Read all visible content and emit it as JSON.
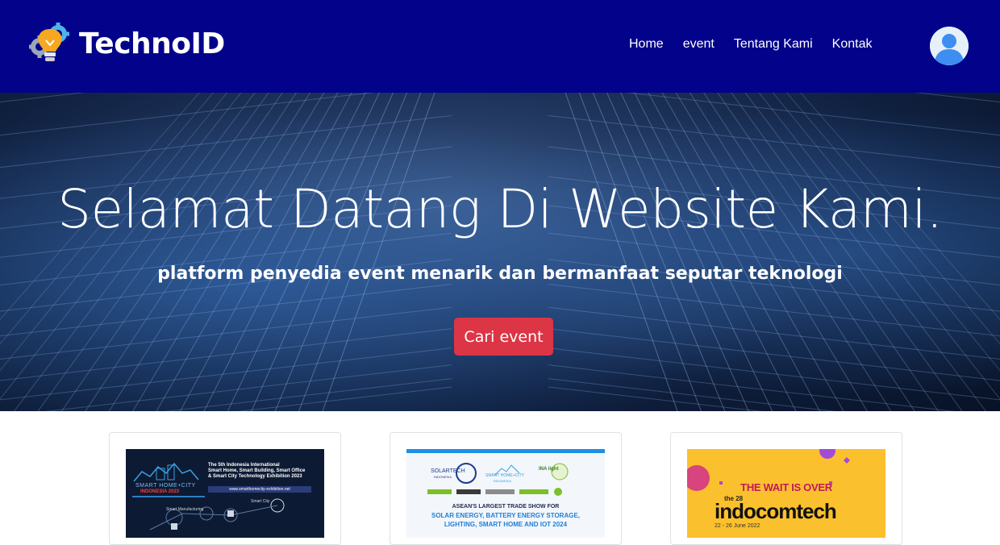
{
  "brand": {
    "name": "TechnoID",
    "logo_icon": "lightbulb-gear-icon"
  },
  "nav": {
    "items": [
      {
        "label": "Home"
      },
      {
        "label": "event"
      },
      {
        "label": "Tentang Kami"
      },
      {
        "label": "Kontak"
      }
    ],
    "avatar_icon": "user-avatar-icon"
  },
  "hero": {
    "title": "Selamat Datang Di Website Kami.",
    "subtitle": "platform penyedia event menarik dan bermanfaat seputar teknologi",
    "button_label": "Cari event"
  },
  "events": [
    {
      "name": "SMART HOME+CITY INDONESIA 2023",
      "poster_lines": [
        "The 5th Indonesia International",
        "Smart Home, Smart Building, Smart Office",
        "& Smart City Technology Exhibition 2023",
        "www.smarthomecity-exhibition.net",
        "SMART HOME+CITY",
        "INDONESIA 2023",
        "Smart Manufacturing",
        "Smart City"
      ]
    },
    {
      "name": "Solartech Indonesia 2024",
      "poster_lines": [
        "SOLARTECH",
        "INDONESIA",
        "SMART HOME+CITY",
        "INDONESIA",
        "INA light",
        "ASEAN'S LARGEST TRADE SHOW FOR",
        "SOLAR ENERGY, BATTERY ENERGY STORAGE,",
        "LIGHTING, SMART HOME AND IOT 2024"
      ]
    },
    {
      "name": "Indocomtech",
      "poster_lines": [
        "THE WAIT IS OVER",
        "the 28",
        "indocomtech",
        "22 - 26 June 2022"
      ]
    }
  ],
  "colors": {
    "navbar": "#02028a",
    "button": "#dc3545",
    "hero_dark": "#0f1f3e"
  }
}
